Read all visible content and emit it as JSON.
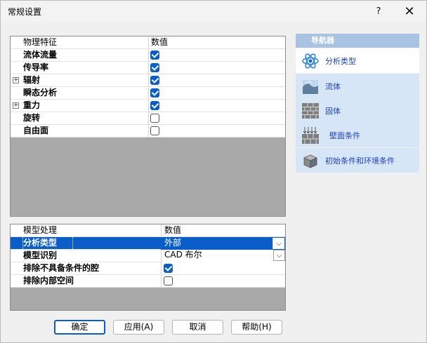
{
  "window": {
    "title": "常规设置",
    "help_label": "?",
    "close_label": "✕"
  },
  "physics_grid": {
    "headers": [
      "物理特征",
      "数值"
    ],
    "rows": [
      {
        "label": "流体流量",
        "checked": true,
        "expandable": false
      },
      {
        "label": "传导率",
        "checked": true,
        "expandable": false
      },
      {
        "label": "辐射",
        "checked": true,
        "expandable": true
      },
      {
        "label": "瞬态分析",
        "checked": true,
        "expandable": false
      },
      {
        "label": "重力",
        "checked": true,
        "expandable": true
      },
      {
        "label": "旋转",
        "checked": false,
        "expandable": false
      },
      {
        "label": "自由面",
        "checked": false,
        "expandable": false
      }
    ],
    "expander_glyph": "+"
  },
  "model_grid": {
    "headers": [
      "模型处理",
      "数值"
    ],
    "rows": [
      {
        "label": "分析类型",
        "type": "dropdown",
        "value": "外部",
        "selected": true
      },
      {
        "label": "模型识别",
        "type": "dropdown",
        "value": "CAD 布尔",
        "selected": false
      },
      {
        "label": "排除不具备条件的腔",
        "type": "checkbox",
        "checked": true
      },
      {
        "label": "排除内部空间",
        "type": "checkbox",
        "checked": false
      }
    ],
    "dropdown_glyph": "⌵"
  },
  "navigator": {
    "title": "导航器",
    "items": [
      {
        "label": "分析类型",
        "icon": "atom-icon",
        "active": true
      },
      {
        "label": "流体",
        "icon": "fluid-flow-icon",
        "active": false
      },
      {
        "label": "固体",
        "icon": "brick-wall-icon",
        "active": false
      },
      {
        "label": "壁面条件",
        "icon": "wall-heat-icon",
        "active": false
      },
      {
        "label": "初始条件和环境条件",
        "icon": "cube-icon",
        "active": false
      }
    ]
  },
  "buttons": {
    "ok": "确定",
    "apply": "应用(A)",
    "cancel": "取消",
    "help": "帮助(H)"
  },
  "colors": {
    "accent": "#0a5ec9",
    "nav_item_bg": "#d6e6f7",
    "nav_header_bg": "#a9c3e3",
    "nav_text": "#1f3fc4"
  }
}
